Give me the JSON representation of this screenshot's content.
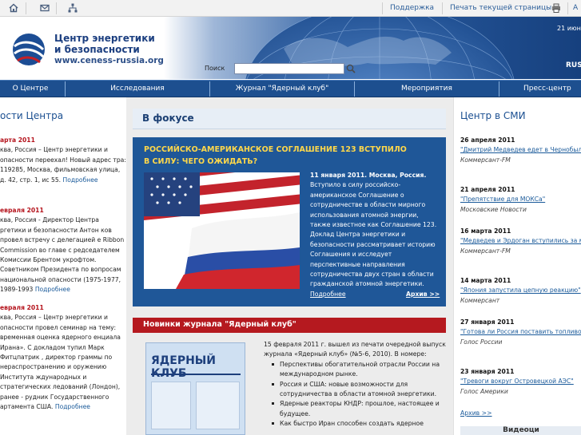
{
  "topbar": {
    "icons": [
      "home-icon",
      "mail-icon",
      "sitemap-icon"
    ],
    "support": "Поддержка",
    "print": "Печать текущей страницы",
    "lang_short": "А"
  },
  "header": {
    "logo_line1": "Центр энергетики",
    "logo_line2": "и безопасности",
    "logo_url": "www.ceness-russia.org",
    "search_label": "Поиск",
    "search_value": "",
    "date": "21 июн",
    "lang": "RUS"
  },
  "nav": [
    "О Центре",
    "Исследования",
    "Журнал \"Ядерный клуб\"",
    "Мероприятия",
    "Пресс-центр"
  ],
  "left": {
    "title": "ости Центра",
    "news": [
      {
        "date": "арта 2011",
        "text": "ква, Россия – Центр энергетики и опасности переехал! Новый адрес тра: 119285, Москва, фильмовская улица, д. 42, стр. 1, ис 55.",
        "more": "Подробнее"
      },
      {
        "date": "евраля 2011",
        "text": "ква, Россия - Директор Центра ргетики и безопасности Антон ков провел встречу с делегацией e Ribbon Commission во главе с редседателем Комиссии Брентом укрофтом. Советником Президента по вопросам национальной опасности (1975-1977, 1989-1993",
        "more": "Подробнее"
      },
      {
        "date": "евраля 2011",
        "text": "ква, Россия – Центр энергетики и опасности провел семинар на тему: временная оценка ядерного енциала Ирана». С докладом тупил Марк Фитцпатрик , директор граммы по нераспространению и оружению Института ждународных и стратегических ледований (Лондон), ранее - рудник Государственного артамента США.",
        "more": "Подробнее"
      }
    ]
  },
  "focus": {
    "title": "В фокусе",
    "headline": "РОССИЙСКО-АМЕРИКАНСКОЕ СОГЛАШЕНИЕ 123 ВСТУПИЛО В СИЛУ: ЧЕГО ОЖИДАТЬ?",
    "dateline": "11 января 2011. Москва, Россия.",
    "text": "Вступило в силу российско-американское Соглашение о сотрудничестве в области мирного использования атомной энергии, также известное как Соглашение 123. Доклад Центра энергетики и безопасности рассматривает историю Соглашения и исследует перспективные направления сотрудничества двух стран в области гражданской атомной энергетики.",
    "more": "Подробнее",
    "archive": "Архив >>"
  },
  "journal": {
    "title": "Новинки журнала \"Ядерный клуб\"",
    "cover_text": "ЯДЕРНЫЙ КЛУБ",
    "intro": "15 февраля 2011 г. вышел из печати очередной выпуск журнала «Ядерный клуб» (№5-6, 2010). В номере:",
    "items": [
      "Перспективы обогатительной отрасли России на международном рынке.",
      "Россия и США: новые возможности для сотрудничества в области атомной энергетики.",
      "Ядерные реакторы КНДР: прошлое, настоящее и будущее.",
      "Как быстро Иран способен создать ядерное"
    ]
  },
  "right": {
    "title": "Центр в СМИ",
    "items": [
      {
        "date": "26 апреля 2011",
        "link": "\"Дмитрий Медведев едет в Чернобыль спустя\"",
        "source": "Коммерсант-FM"
      },
      {
        "date": "21 апреля 2011",
        "link": "\"Препятствие для МОКСа\"",
        "source": "Московские Новости"
      },
      {
        "date": "16 марта 2011",
        "link": "\"Медведев и Эрдоган вступились за м атом\"",
        "source": "Коммерсант-FM"
      },
      {
        "date": "14 марта 2011",
        "link": "\"Япония запустила цепную реакцию\"",
        "source": "Коммерсант"
      },
      {
        "date": "27 января 2011",
        "link": "\"Готова ли Россия поставить топливо Тегеранского ядерного реактора?\"",
        "source": "Голос России"
      },
      {
        "date": "23 января 2011",
        "link": "\"Тревоги вокруг Островецкой АЭС\"",
        "source": "Голос Америки"
      }
    ],
    "archive": "Архив >>",
    "video": "Видеоци"
  }
}
